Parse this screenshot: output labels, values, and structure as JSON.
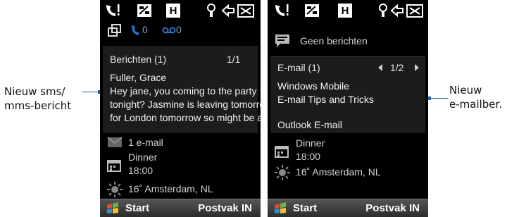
{
  "callouts": {
    "left": [
      "Nieuw sms/",
      "mms-bericht"
    ],
    "right": [
      "Nieuw",
      "e-mailber."
    ]
  },
  "phone1": {
    "status_counts": {
      "missed_calls": "0",
      "voicemail": "0"
    },
    "messages_panel": {
      "header": "Berichten (1)",
      "counter": "1/1",
      "sender": "Fuller, Grace",
      "body_lines": [
        "Hey jane, you coming to the party",
        "tonight? Jasmine is leaving tomorrow",
        "for London tomorrow so might be a ..."
      ]
    },
    "email_summary": "1 e-mail",
    "appointment": {
      "title": "Dinner",
      "time": "18:00"
    },
    "weather": "16˚ Amsterdam, NL"
  },
  "phone2": {
    "no_messages": "Geen berichten",
    "email_panel": {
      "header": "E-mail (1)",
      "counter": "1/2",
      "subject_lines": [
        "Windows Mobile",
        "E-mail Tips and Tricks"
      ],
      "account": "Outlook E-mail"
    },
    "appointment": {
      "title": "Dinner",
      "time": "18:00"
    },
    "weather": "16˚ Amsterdam, NL"
  },
  "softkeys": {
    "left": "Start",
    "right": "Postvak IN"
  },
  "colors": {
    "leader": "#1a5fb4",
    "panel": "#1c1c1c",
    "screen": "#000000",
    "missed_call_icon": "#2e72c8"
  },
  "icons": [
    "signal-icon",
    "data-icon",
    "hspa-icon",
    "bluetooth-icon",
    "battery-icon",
    "tab-toggle-icon",
    "missed-call-icon",
    "voicemail-icon",
    "message-icon",
    "envelope-icon",
    "calendar-icon",
    "sun-icon",
    "windows-flag-icon",
    "prev-arrow-icon",
    "next-arrow-icon"
  ]
}
